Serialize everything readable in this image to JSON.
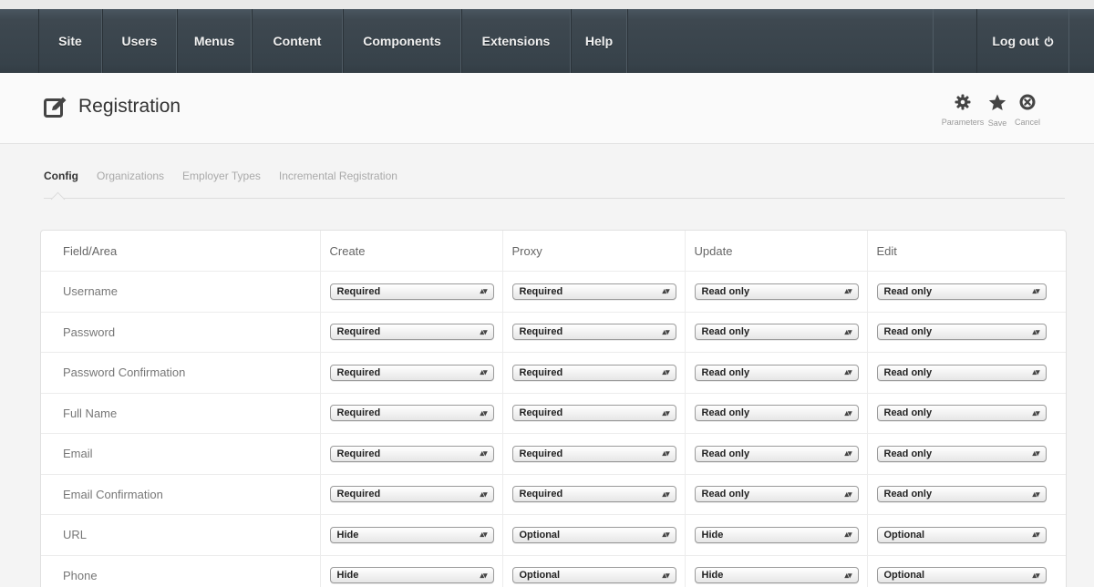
{
  "nav": {
    "items": [
      {
        "label": "Site",
        "w": 70
      },
      {
        "label": "Users",
        "w": 82
      },
      {
        "label": "Menus",
        "w": 82
      },
      {
        "label": "Content",
        "w": 100
      },
      {
        "label": "Components",
        "w": 130
      },
      {
        "label": "Extensions",
        "w": 120
      },
      {
        "label": "Help",
        "w": 62
      }
    ],
    "logout_label": "Log out"
  },
  "header": {
    "title": "Registration",
    "toolbar": {
      "parameters": "Parameters",
      "save": "Save",
      "cancel": "Cancel"
    }
  },
  "tabs": [
    {
      "label": "Config",
      "active": true
    },
    {
      "label": "Organizations",
      "active": false
    },
    {
      "label": "Employer Types",
      "active": false
    },
    {
      "label": "Incremental Registration",
      "active": false
    }
  ],
  "table": {
    "headers": [
      "Field/Area",
      "Create",
      "Proxy",
      "Update",
      "Edit"
    ],
    "rows": [
      {
        "field": "Username",
        "create": "Required",
        "proxy": "Required",
        "update": "Read only",
        "edit": "Read only"
      },
      {
        "field": "Password",
        "create": "Required",
        "proxy": "Required",
        "update": "Read only",
        "edit": "Read only"
      },
      {
        "field": "Password Confirmation",
        "create": "Required",
        "proxy": "Required",
        "update": "Read only",
        "edit": "Read only"
      },
      {
        "field": "Full Name",
        "create": "Required",
        "proxy": "Required",
        "update": "Read only",
        "edit": "Read only"
      },
      {
        "field": "Email",
        "create": "Required",
        "proxy": "Required",
        "update": "Read only",
        "edit": "Read only"
      },
      {
        "field": "Email Confirmation",
        "create": "Required",
        "proxy": "Required",
        "update": "Read only",
        "edit": "Read only"
      },
      {
        "field": "URL",
        "create": "Hide",
        "proxy": "Optional",
        "update": "Hide",
        "edit": "Optional"
      },
      {
        "field": "Phone",
        "create": "Hide",
        "proxy": "Optional",
        "update": "Hide",
        "edit": "Optional"
      }
    ]
  },
  "icons": {
    "edit": "edit-icon",
    "power": "power-icon",
    "gear": "gear-icon",
    "star": "star-icon",
    "cancel": "close-circle-icon"
  }
}
